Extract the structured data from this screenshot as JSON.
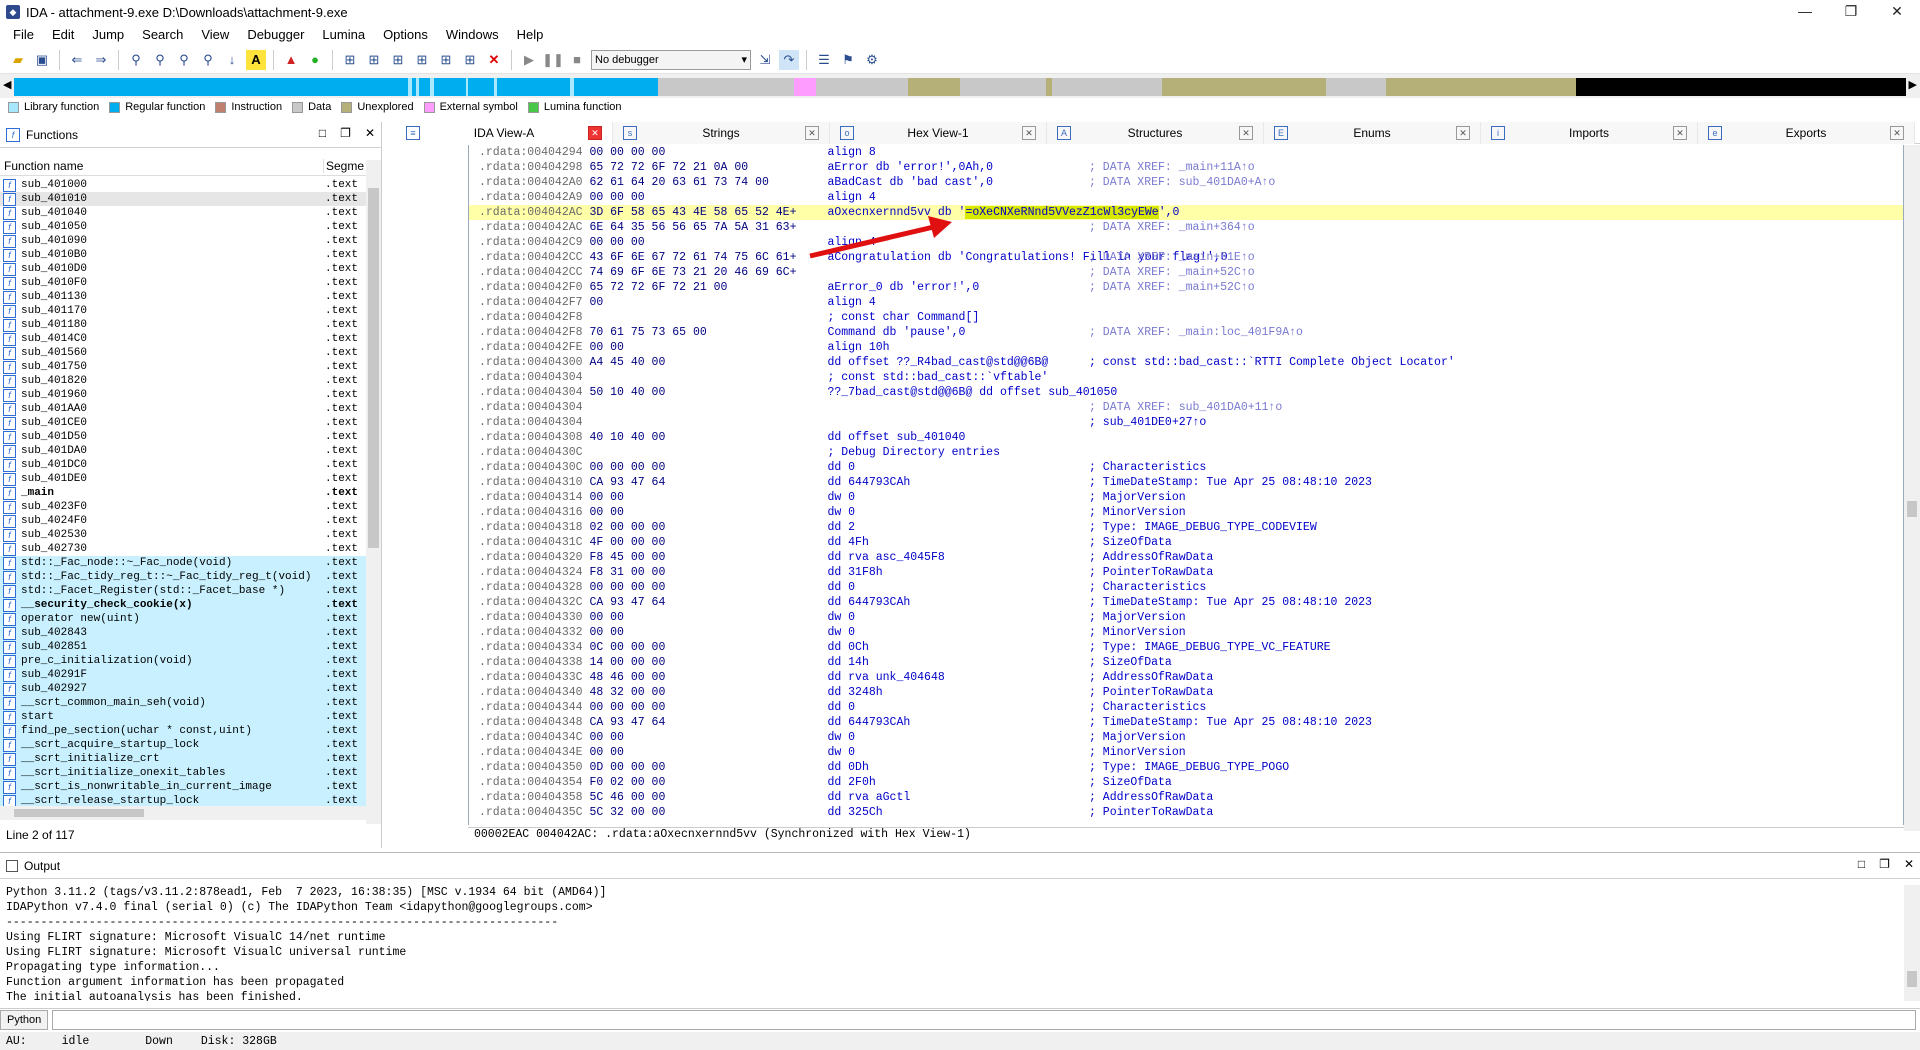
{
  "window": {
    "title": "IDA - attachment-9.exe D:\\Downloads\\attachment-9.exe",
    "min": "—",
    "restore": "❐",
    "close": "✕"
  },
  "menu": [
    "File",
    "Edit",
    "Jump",
    "Search",
    "View",
    "Debugger",
    "Lumina",
    "Options",
    "Windows",
    "Help"
  ],
  "toolbar": {
    "debugger_select": "No debugger"
  },
  "legend": [
    {
      "label": "Library function",
      "color": "#a8e8ff"
    },
    {
      "label": "Regular function",
      "color": "#00aef0"
    },
    {
      "label": "Instruction",
      "color": "#c0806e"
    },
    {
      "label": "Data",
      "color": "#c8c8c8"
    },
    {
      "label": "Unexplored",
      "color": "#b4b078"
    },
    {
      "label": "External symbol",
      "color": "#ff9cff"
    },
    {
      "label": "Lumina function",
      "color": "#48c848"
    }
  ],
  "functions_panel": {
    "title": "Functions",
    "col_name": "Function name",
    "col_segment": "Segme",
    "status": "Line 2 of 117",
    "rows": [
      {
        "name": "sub_401000",
        "seg": ".text"
      },
      {
        "name": "sub_401010",
        "seg": ".text"
      },
      {
        "name": "sub_401040",
        "seg": ".text"
      },
      {
        "name": "sub_401050",
        "seg": ".text"
      },
      {
        "name": "sub_401090",
        "seg": ".text"
      },
      {
        "name": "sub_4010B0",
        "seg": ".text"
      },
      {
        "name": "sub_4010D0",
        "seg": ".text"
      },
      {
        "name": "sub_4010F0",
        "seg": ".text"
      },
      {
        "name": "sub_401130",
        "seg": ".text"
      },
      {
        "name": "sub_401170",
        "seg": ".text"
      },
      {
        "name": "sub_401180",
        "seg": ".text"
      },
      {
        "name": "sub_4014C0",
        "seg": ".text"
      },
      {
        "name": "sub_401560",
        "seg": ".text"
      },
      {
        "name": "sub_401750",
        "seg": ".text"
      },
      {
        "name": "sub_401820",
        "seg": ".text"
      },
      {
        "name": "sub_401960",
        "seg": ".text"
      },
      {
        "name": "sub_401AA0",
        "seg": ".text"
      },
      {
        "name": "sub_401CE0",
        "seg": ".text"
      },
      {
        "name": "sub_401D50",
        "seg": ".text"
      },
      {
        "name": "sub_401DA0",
        "seg": ".text"
      },
      {
        "name": "sub_401DC0",
        "seg": ".text"
      },
      {
        "name": "sub_401DE0",
        "seg": ".text"
      },
      {
        "name": "_main",
        "seg": ".text"
      },
      {
        "name": "sub_4023F0",
        "seg": ".text"
      },
      {
        "name": "sub_4024F0",
        "seg": ".text"
      },
      {
        "name": "sub_402530",
        "seg": ".text"
      },
      {
        "name": "sub_402730",
        "seg": ".text"
      },
      {
        "name": "std::_Fac_node::~_Fac_node(void)",
        "seg": ".text"
      },
      {
        "name": "std::_Fac_tidy_reg_t::~_Fac_tidy_reg_t(void)",
        "seg": ".text"
      },
      {
        "name": "std::_Facet_Register(std::_Facet_base *)",
        "seg": ".text"
      },
      {
        "name": "__security_check_cookie(x)",
        "seg": ".text"
      },
      {
        "name": "operator new(uint)",
        "seg": ".text"
      },
      {
        "name": "sub_402843",
        "seg": ".text"
      },
      {
        "name": "sub_402851",
        "seg": ".text"
      },
      {
        "name": "pre_c_initialization(void)",
        "seg": ".text"
      },
      {
        "name": "sub_40291F",
        "seg": ".text"
      },
      {
        "name": "sub_402927",
        "seg": ".text"
      },
      {
        "name": "__scrt_common_main_seh(void)",
        "seg": ".text"
      },
      {
        "name": "start",
        "seg": ".text"
      },
      {
        "name": "find_pe_section(uchar * const,uint)",
        "seg": ".text"
      },
      {
        "name": "__scrt_acquire_startup_lock",
        "seg": ".text"
      },
      {
        "name": "__scrt_initialize_crt",
        "seg": ".text"
      },
      {
        "name": "__scrt_initialize_onexit_tables",
        "seg": ".text"
      },
      {
        "name": "__scrt_is_nonwritable_in_current_image",
        "seg": ".text"
      },
      {
        "name": "__scrt_release_startup_lock",
        "seg": ".text"
      }
    ]
  },
  "tabs": [
    {
      "label": "IDA View-A",
      "icon": "≡"
    },
    {
      "label": "Strings",
      "icon": "s"
    },
    {
      "label": "Hex View-1",
      "icon": "o"
    },
    {
      "label": "Structures",
      "icon": "A"
    },
    {
      "label": "Enums",
      "icon": "E"
    },
    {
      "label": "Imports",
      "icon": "i"
    },
    {
      "label": "Exports",
      "icon": "e"
    }
  ],
  "disasm": [
    {
      "addr": ".rdata:00404294",
      "bytes": "00 00 00 00",
      "code": "align 8",
      "cmt": ""
    },
    {
      "addr": ".rdata:00404298",
      "bytes": "65 72 72 6F 72 21 0A 00",
      "code": "aError db 'error!',0Ah,0",
      "cmt": "; DATA XREF: _main+11A↑o"
    },
    {
      "addr": ".rdata:004042A0",
      "bytes": "62 61 64 20 63 61 73 74 00",
      "code": "aBadCast db 'bad cast',0",
      "cmt": "; DATA XREF: sub_401DA0+A↑o"
    },
    {
      "addr": ".rdata:004042A9",
      "bytes": "00 00 00",
      "code": "align 4",
      "cmt": ""
    },
    {
      "addr": ".rdata:004042AC",
      "bytes": "3D 6F 58 65 43 4E 58 65 52 4E+",
      "code": "aOxecnxernnd5vv db '",
      "hex": "=oXeCNXeRNnd5VVezZ1cWl3cyEWe",
      "post": "',0",
      "cmt": "",
      "hl": true
    },
    {
      "addr": ".rdata:004042AC",
      "bytes": "6E 64 35 56 56 65 7A 5A 31 63+",
      "code": "",
      "cmt": "; DATA XREF: _main+364↑o"
    },
    {
      "addr": ".rdata:004042C9",
      "bytes": "00 00 00",
      "code": "align 4",
      "cmt": ""
    },
    {
      "addr": ".rdata:004042CC",
      "bytes": "43 6F 6E 67 72 61 74 75 6C 61+",
      "code": "aCongratulation db 'Congratulations! Fill in your flag!',0",
      "cmt": "; DATA XREF: _main+51E↑o"
    },
    {
      "addr": ".rdata:004042CC",
      "bytes": "74 69 6F 6E 73 21 20 46 69 6C+",
      "code": "",
      "cmt": "; DATA XREF: _main+52C↑o"
    },
    {
      "addr": ".rdata:004042F0",
      "bytes": "65 72 72 6F 72 21 00",
      "code": "aError_0 db 'error!',0",
      "cmt": "; DATA XREF: _main+52C↑o"
    },
    {
      "addr": ".rdata:004042F7",
      "bytes": "00",
      "code": "align 4",
      "cmt": ""
    },
    {
      "addr": ".rdata:004042F8",
      "bytes": "",
      "code": "; const char Command[]",
      "cmt": ""
    },
    {
      "addr": ".rdata:004042F8",
      "bytes": "70 61 75 73 65 00",
      "code": "Command db 'pause',0",
      "cmt": "; DATA XREF: _main:loc_401F9A↑o"
    },
    {
      "addr": ".rdata:004042FE",
      "bytes": "00 00",
      "code": "align 10h",
      "cmt": ""
    },
    {
      "addr": ".rdata:00404300",
      "bytes": "A4 45 40 00",
      "code": "dd offset ??_R4bad_cast@std@@6B@",
      "cmt": "; const std::bad_cast::`RTTI Complete Object Locator'"
    },
    {
      "addr": ".rdata:00404304",
      "bytes": "",
      "code": "; const std::bad_cast::`vftable'",
      "cmt": ""
    },
    {
      "addr": ".rdata:00404304",
      "bytes": "50 10 40 00",
      "code": "??_7bad_cast@std@@6B@ dd offset sub_401050",
      "cmt": ""
    },
    {
      "addr": ".rdata:00404304",
      "bytes": "",
      "code": "",
      "cmt": "; DATA XREF: sub_401DA0+11↑o"
    },
    {
      "addr": ".rdata:00404304",
      "bytes": "",
      "code": "",
      "cmt": "; sub_401DE0+27↑o"
    },
    {
      "addr": ".rdata:00404308",
      "bytes": "40 10 40 00",
      "code": "dd offset sub_401040",
      "cmt": ""
    },
    {
      "addr": ".rdata:0040430C",
      "bytes": "",
      "code": "; Debug Directory entries",
      "cmt": ""
    },
    {
      "addr": ".rdata:0040430C",
      "bytes": "00 00 00 00",
      "code": "dd 0",
      "cmt": "; Characteristics"
    },
    {
      "addr": ".rdata:00404310",
      "bytes": "CA 93 47 64",
      "code": "dd 644793CAh",
      "cmt": "; TimeDateStamp: Tue Apr 25 08:48:10 2023"
    },
    {
      "addr": ".rdata:00404314",
      "bytes": "00 00",
      "code": "dw 0",
      "cmt": "; MajorVersion"
    },
    {
      "addr": ".rdata:00404316",
      "bytes": "00 00",
      "code": "dw 0",
      "cmt": "; MinorVersion"
    },
    {
      "addr": ".rdata:00404318",
      "bytes": "02 00 00 00",
      "code": "dd 2",
      "cmt": "; Type: IMAGE_DEBUG_TYPE_CODEVIEW"
    },
    {
      "addr": ".rdata:0040431C",
      "bytes": "4F 00 00 00",
      "code": "dd 4Fh",
      "cmt": "; SizeOfData"
    },
    {
      "addr": ".rdata:00404320",
      "bytes": "F8 45 00 00",
      "code": "dd rva asc_4045F8",
      "cmt": "; AddressOfRawData"
    },
    {
      "addr": ".rdata:00404324",
      "bytes": "F8 31 00 00",
      "code": "dd 31F8h",
      "cmt": "; PointerToRawData"
    },
    {
      "addr": ".rdata:00404328",
      "bytes": "00 00 00 00",
      "code": "dd 0",
      "cmt": "; Characteristics"
    },
    {
      "addr": ".rdata:0040432C",
      "bytes": "CA 93 47 64",
      "code": "dd 644793CAh",
      "cmt": "; TimeDateStamp: Tue Apr 25 08:48:10 2023"
    },
    {
      "addr": ".rdata:00404330",
      "bytes": "00 00",
      "code": "dw 0",
      "cmt": "; MajorVersion"
    },
    {
      "addr": ".rdata:00404332",
      "bytes": "00 00",
      "code": "dw 0",
      "cmt": "; MinorVersion"
    },
    {
      "addr": ".rdata:00404334",
      "bytes": "0C 00 00 00",
      "code": "dd 0Ch",
      "cmt": "; Type: IMAGE_DEBUG_TYPE_VC_FEATURE"
    },
    {
      "addr": ".rdata:00404338",
      "bytes": "14 00 00 00",
      "code": "dd 14h",
      "cmt": "; SizeOfData"
    },
    {
      "addr": ".rdata:0040433C",
      "bytes": "48 46 00 00",
      "code": "dd rva unk_404648",
      "cmt": "; AddressOfRawData"
    },
    {
      "addr": ".rdata:00404340",
      "bytes": "48 32 00 00",
      "code": "dd 3248h",
      "cmt": "; PointerToRawData"
    },
    {
      "addr": ".rdata:00404344",
      "bytes": "00 00 00 00",
      "code": "dd 0",
      "cmt": "; Characteristics"
    },
    {
      "addr": ".rdata:00404348",
      "bytes": "CA 93 47 64",
      "code": "dd 644793CAh",
      "cmt": "; TimeDateStamp: Tue Apr 25 08:48:10 2023"
    },
    {
      "addr": ".rdata:0040434C",
      "bytes": "00 00",
      "code": "dw 0",
      "cmt": "; MajorVersion"
    },
    {
      "addr": ".rdata:0040434E",
      "bytes": "00 00",
      "code": "dw 0",
      "cmt": "; MinorVersion"
    },
    {
      "addr": ".rdata:00404350",
      "bytes": "0D 00 00 00",
      "code": "dd 0Dh",
      "cmt": "; Type: IMAGE_DEBUG_TYPE_POGO"
    },
    {
      "addr": ".rdata:00404354",
      "bytes": "F0 02 00 00",
      "code": "dd 2F0h",
      "cmt": "; SizeOfData"
    },
    {
      "addr": ".rdata:00404358",
      "bytes": "5C 46 00 00",
      "code": "dd rva aGctl",
      "cmt": "; AddressOfRawData"
    },
    {
      "addr": ".rdata:0040435C",
      "bytes": "5C 32 00 00",
      "code": "dd 325Ch",
      "cmt": "; PointerToRawData"
    }
  ],
  "disasm_status": "00002EAC 004042AC: .rdata:aOxecnxernnd5vv (Synchronized with Hex View-1)",
  "output": {
    "title": "Output",
    "lines": [
      "Python 3.11.2 (tags/v3.11.2:878ead1, Feb  7 2023, 16:38:35) [MSC v.1934 64 bit (AMD64)]",
      "IDAPython v7.4.0 final (serial 0) (c) The IDAPython Team <idapython@googlegroups.com>",
      "--------------------------------------------------------------------------------",
      "Using FLIRT signature: Microsoft VisualC 14/net runtime",
      "Using FLIRT signature: Microsoft VisualC universal runtime",
      "Propagating type information...",
      "Function argument information has been propagated",
      "The initial autoanalysis has been finished."
    ],
    "python_btn": "Python"
  },
  "statusbar": {
    "au": "AU:",
    "state": "idle",
    "dir": "Down",
    "disk": "Disk: 328GB"
  }
}
